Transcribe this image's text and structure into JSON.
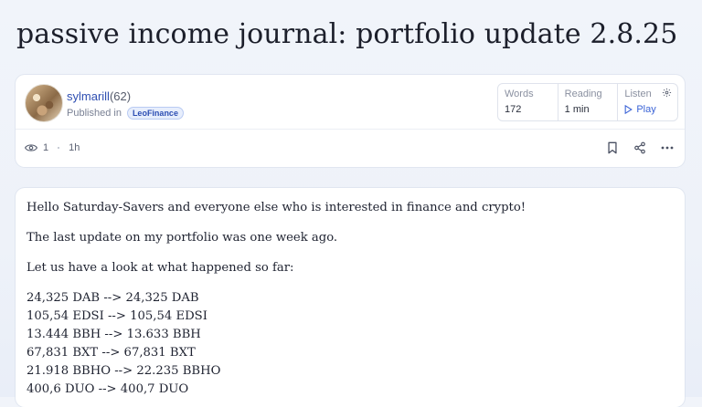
{
  "post": {
    "title": "passive income journal: portfolio update 2.8.25",
    "author": "sylmarill",
    "reputation": "(62)",
    "published_label": "Published in",
    "community": "LeoFinance",
    "views": "1",
    "age": "1h"
  },
  "stats": {
    "words_label": "Words",
    "words_value": "172",
    "reading_label": "Reading",
    "reading_value": "1 min",
    "listen_label": "Listen",
    "play_label": "Play"
  },
  "icons": {
    "views": "eye-icon",
    "settings": "gear-icon",
    "play": "play-icon",
    "bookmark": "bookmark-icon",
    "share": "share-icon",
    "more": "more-icon"
  },
  "body": {
    "paragraphs": [
      "Hello Saturday-Savers and everyone else who is interested in finance and crypto!",
      "The last update on my portfolio was one week ago.",
      "Let us have a look at what happened so far:"
    ],
    "holdings": [
      "24,325 DAB --> 24,325 DAB",
      "105,54 EDSI --> 105,54 EDSI",
      "13.444 BBH --> 13.633 BBH",
      "67,831 BXT --> 67,831 BXT",
      "21.918 BBHO --> 22.235 BBHO",
      "400,6 DUO --> 400,7 DUO"
    ]
  },
  "colors": {
    "accent": "#3a63d6",
    "author_link": "#2f4fb2",
    "badge_bg": "#e7eefc"
  }
}
